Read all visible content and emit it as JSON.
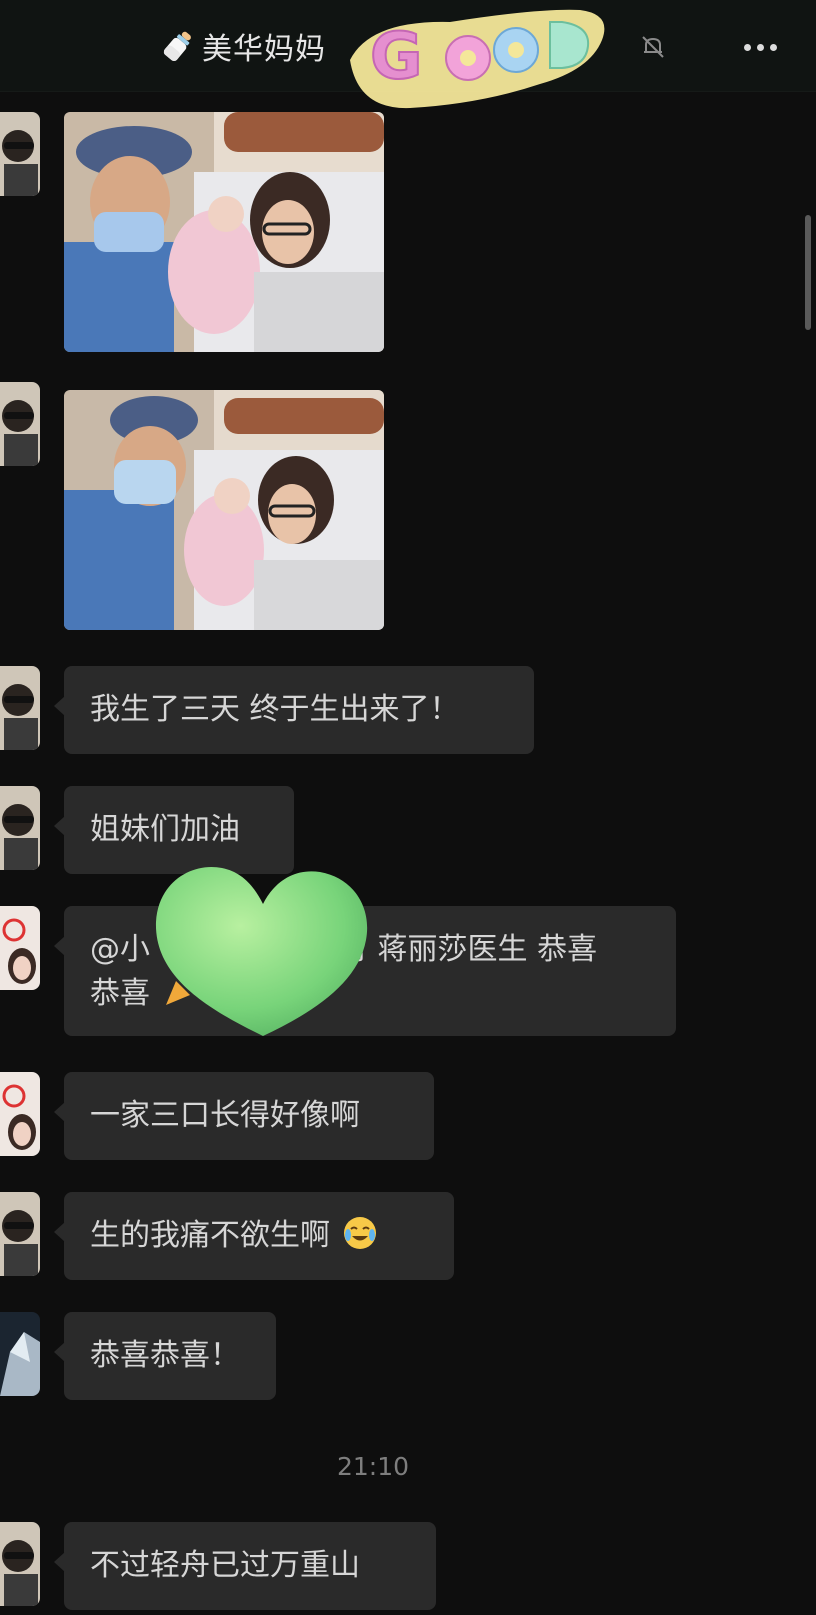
{
  "header": {
    "title": "美华妈妈",
    "bottle_icon": "baby-bottle-icon",
    "mute_icon": "bell-muted-icon",
    "more_icon": "more-dots-icon"
  },
  "messages": [
    {
      "sender": "user-a",
      "type": "image",
      "desc": "hospital-photo-1"
    },
    {
      "sender": "user-a",
      "type": "image",
      "desc": "hospital-photo-2"
    },
    {
      "sender": "user-a",
      "type": "text",
      "text": "我生了三天 终于生出来了！"
    },
    {
      "sender": "user-a",
      "type": "text",
      "text": "姐妹们加油"
    },
    {
      "sender": "user-b",
      "type": "text",
      "text_line1": "@小",
      "text_line1_end": "月 蒋丽莎医生 恭喜",
      "text_line2": "恭喜"
    },
    {
      "sender": "user-b",
      "type": "text",
      "text": "一家三口长得好像啊"
    },
    {
      "sender": "user-a",
      "type": "text",
      "text": "生的我痛不欲生啊"
    },
    {
      "sender": "user-c",
      "type": "text",
      "text": "恭喜恭喜！"
    },
    {
      "type": "timestamp",
      "text": "21:10"
    },
    {
      "sender": "user-a",
      "type": "text",
      "text": "不过轻舟已过万重山"
    }
  ],
  "stickers": {
    "good": "GOOD",
    "heart": "green-heart-sticker"
  },
  "colors": {
    "background": "#0e0e0e",
    "bubble": "#2a2a2a",
    "text": "#d6d6d6",
    "timestamp": "#7e7e7e"
  }
}
